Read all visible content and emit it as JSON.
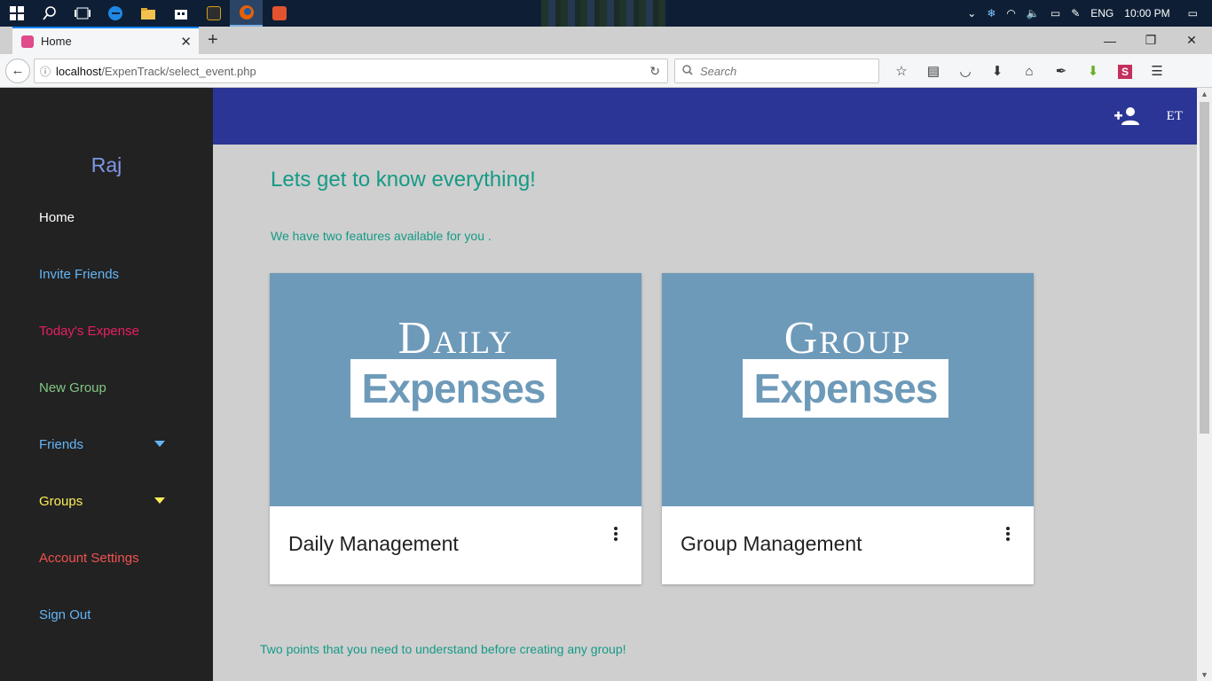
{
  "taskbar": {
    "tray_lang": "ENG",
    "tray_time": "10:00 PM"
  },
  "browser": {
    "tab_title": "Home",
    "url_host": "localhost",
    "url_path": "/ExpenTrack/select_event.php",
    "search_placeholder": "Search"
  },
  "sidebar": {
    "profile_name": "Raj",
    "items": [
      {
        "label": "Home",
        "color": "#ffffff"
      },
      {
        "label": "Invite Friends",
        "color": "#64b5f6"
      },
      {
        "label": "Today's Expense",
        "color": "#e91e63"
      },
      {
        "label": "New Group",
        "color": "#81c784"
      },
      {
        "label": "Friends",
        "color": "#64b5f6",
        "caret_color": "#64b5f6"
      },
      {
        "label": "Groups",
        "color": "#ffee58",
        "caret_color": "#ffee58"
      },
      {
        "label": "Account Settings",
        "color": "#ef5350"
      },
      {
        "label": "Sign Out",
        "color": "#64b5f6"
      }
    ]
  },
  "topbar": {
    "badge": "ET",
    "color": "#2b3595"
  },
  "main": {
    "headline": "Lets get to know everything!",
    "subline": "We have two features available for you .",
    "cards": [
      {
        "image_word": "Daily",
        "image_box": "Expenses",
        "title": "Daily Management"
      },
      {
        "image_word": "Group",
        "image_box": "Expenses",
        "title": "Group Management"
      }
    ],
    "bottom_note": "Two points that you need to understand before creating any group!"
  }
}
